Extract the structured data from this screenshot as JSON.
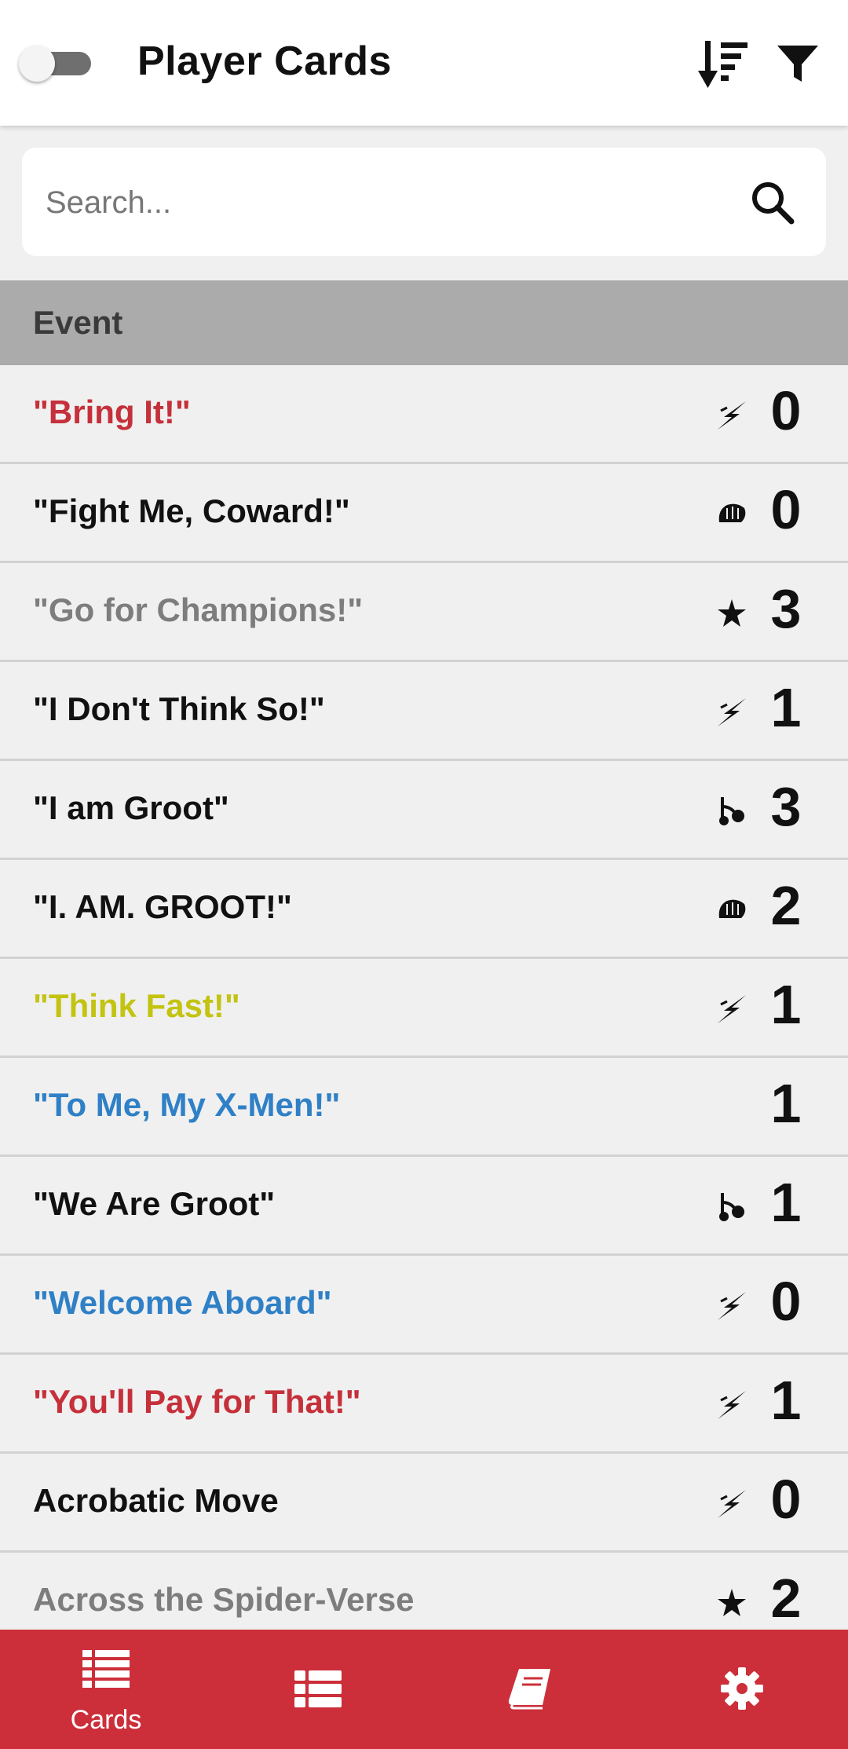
{
  "header": {
    "title": "Player Cards",
    "toggle_on": false
  },
  "search": {
    "placeholder": "Search..."
  },
  "section": {
    "title": "Event"
  },
  "cards": [
    {
      "name": "\"Bring It!\"",
      "color": "#c5303a",
      "icon": "bolt-icon",
      "cost": "0"
    },
    {
      "name": "\"Fight Me, Coward!\"",
      "color": "#111111",
      "icon": "fist-icon",
      "cost": "0"
    },
    {
      "name": "\"Go for Champions!\"",
      "color": "#7d7d7d",
      "icon": "star-icon",
      "cost": "3"
    },
    {
      "name": "\"I Don't Think So!\"",
      "color": "#111111",
      "icon": "bolt-icon",
      "cost": "1"
    },
    {
      "name": "\"I am Groot\"",
      "color": "#111111",
      "icon": "branch-icon",
      "cost": "3"
    },
    {
      "name": "\"I. AM. GROOT!\"",
      "color": "#111111",
      "icon": "fist-icon",
      "cost": "2"
    },
    {
      "name": "\"Think Fast!\"",
      "color": "#c3c312",
      "icon": "bolt-icon",
      "cost": "1"
    },
    {
      "name": "\"To Me, My X-Men!\"",
      "color": "#2f80c6",
      "icon": "",
      "cost": "1"
    },
    {
      "name": "\"We Are Groot\"",
      "color": "#111111",
      "icon": "branch-icon",
      "cost": "1"
    },
    {
      "name": "\"Welcome Aboard\"",
      "color": "#2f80c6",
      "icon": "bolt-icon",
      "cost": "0"
    },
    {
      "name": "\"You'll Pay for That!\"",
      "color": "#c5303a",
      "icon": "bolt-icon",
      "cost": "1"
    },
    {
      "name": "Acrobatic Move",
      "color": "#111111",
      "icon": "bolt-icon",
      "cost": "0"
    },
    {
      "name": "Across the Spider-Verse",
      "color": "#7d7d7d",
      "icon": "star-icon",
      "cost": "2"
    }
  ],
  "bottom_nav": {
    "items": [
      {
        "label": "Cards",
        "icon": "card-list-icon",
        "active": true
      },
      {
        "label": "",
        "icon": "list-icon",
        "active": false
      },
      {
        "label": "",
        "icon": "book-icon",
        "active": false
      },
      {
        "label": "",
        "icon": "gear-icon",
        "active": false
      }
    ],
    "color": "#cc2f3a"
  }
}
